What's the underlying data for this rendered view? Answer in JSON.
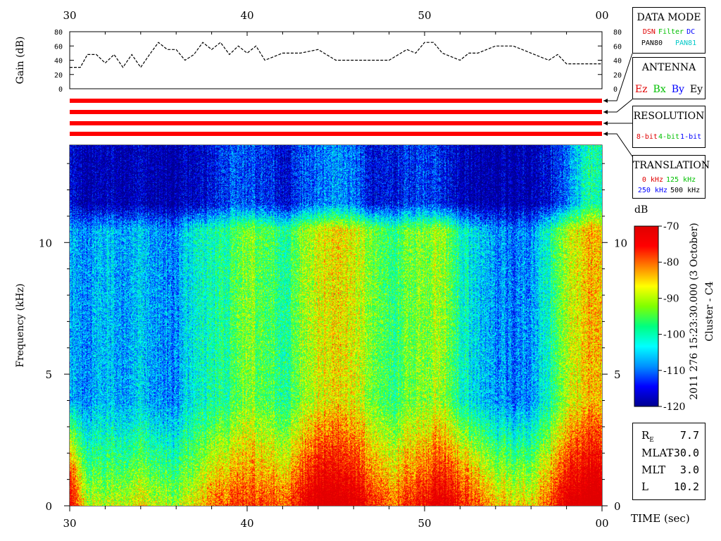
{
  "chart_data": {
    "type": "heatmap",
    "title": "2011 276 15:23:30.000 (3 October)",
    "subtitle": "Cluster - C4",
    "xlabel": "TIME (sec)",
    "x_tick_labels": [
      "30",
      "40",
      "50",
      "00"
    ],
    "xlim": [
      30,
      60
    ],
    "gain_panel": {
      "ylabel": "Gain (dB)",
      "ylim": [
        0,
        80
      ],
      "y_tick_labels": [
        "0",
        "20",
        "40",
        "60",
        "80"
      ],
      "series": {
        "x": [
          30,
          30.6,
          31,
          31.5,
          32,
          32.5,
          33,
          33.5,
          34,
          34.5,
          35,
          35.5,
          36,
          36.5,
          37,
          37.5,
          38,
          38.5,
          39,
          39.5,
          40,
          40.5,
          41,
          42,
          43,
          44,
          45,
          46,
          47,
          48,
          49,
          49.5,
          50,
          50.5,
          51,
          52,
          52.5,
          53,
          54,
          55,
          56,
          57,
          57.5,
          58,
          58.5,
          59,
          60
        ],
        "y": [
          30,
          30,
          48,
          48,
          36,
          48,
          30,
          48,
          30,
          48,
          65,
          55,
          55,
          40,
          48,
          65,
          55,
          65,
          48,
          60,
          50,
          60,
          40,
          50,
          50,
          55,
          40,
          40,
          40,
          40,
          55,
          50,
          65,
          65,
          50,
          40,
          50,
          50,
          60,
          60,
          50,
          40,
          48,
          35,
          35,
          35,
          35
        ]
      }
    },
    "indicator_bars": 4,
    "spectrogram": {
      "ylabel": "Frequency (kHz)",
      "ylim": [
        0,
        13.7
      ],
      "y_tick_labels": [
        "0",
        "5",
        "10"
      ],
      "colorbar": {
        "unit": "dB",
        "range": [
          -120,
          -70
        ],
        "tick_labels": [
          "-70",
          "-80",
          "-90",
          "-100",
          "-110",
          "-120"
        ],
        "colors": [
          "#000090",
          "#0000ff",
          "#0090ff",
          "#00ffff",
          "#00ff80",
          "#80ff00",
          "#ffff00",
          "#ff8000",
          "#ff0000",
          "#e00000"
        ]
      },
      "time_bins": [
        {
          "t": 30,
          "lowband": -78,
          "midband": -108,
          "upper": -118
        },
        {
          "t": 31,
          "lowband": -95,
          "midband": -108,
          "upper": -120
        },
        {
          "t": 32,
          "lowband": -96,
          "midband": -106,
          "upper": -119
        },
        {
          "t": 33,
          "lowband": -95,
          "midband": -108,
          "upper": -120
        },
        {
          "t": 34,
          "lowband": -92,
          "midband": -105,
          "upper": -118
        },
        {
          "t": 35,
          "lowband": -95,
          "midband": -108,
          "upper": -120
        },
        {
          "t": 36,
          "lowband": -97,
          "midband": -109,
          "upper": -120
        },
        {
          "t": 37,
          "lowband": -92,
          "midband": -102,
          "upper": -118
        },
        {
          "t": 38,
          "lowband": -86,
          "midband": -100,
          "upper": -116
        },
        {
          "t": 39,
          "lowband": -84,
          "midband": -98,
          "upper": -112
        },
        {
          "t": 40,
          "lowband": -82,
          "midband": -92,
          "upper": -112
        },
        {
          "t": 41,
          "lowband": -82,
          "midband": -94,
          "upper": -112
        },
        {
          "t": 42,
          "lowband": -86,
          "midband": -100,
          "upper": -118
        },
        {
          "t": 43,
          "lowband": -78,
          "midband": -92,
          "upper": -112
        },
        {
          "t": 44,
          "lowband": -72,
          "midband": -88,
          "upper": -110
        },
        {
          "t": 45,
          "lowband": -72,
          "midband": -86,
          "upper": -108
        },
        {
          "t": 46,
          "lowband": -74,
          "midband": -88,
          "upper": -110
        },
        {
          "t": 47,
          "lowband": -80,
          "midband": -92,
          "upper": -116
        },
        {
          "t": 48,
          "lowband": -86,
          "midband": -98,
          "upper": -116
        },
        {
          "t": 49,
          "lowband": -82,
          "midband": -94,
          "upper": -114
        },
        {
          "t": 50,
          "lowband": -78,
          "midband": -92,
          "upper": -112
        },
        {
          "t": 51,
          "lowband": -74,
          "midband": -90,
          "upper": -114
        },
        {
          "t": 52,
          "lowband": -80,
          "midband": -100,
          "upper": -118
        },
        {
          "t": 53,
          "lowband": -84,
          "midband": -104,
          "upper": -119
        },
        {
          "t": 54,
          "lowband": -90,
          "midband": -108,
          "upper": -120
        },
        {
          "t": 55,
          "lowband": -92,
          "midband": -110,
          "upper": -120
        },
        {
          "t": 56,
          "lowband": -92,
          "midband": -108,
          "upper": -119
        },
        {
          "t": 57,
          "lowband": -84,
          "midband": -100,
          "upper": -116
        },
        {
          "t": 58,
          "lowband": -74,
          "midband": -90,
          "upper": -110
        },
        {
          "t": 59,
          "lowband": -70,
          "midband": -84,
          "upper": -100
        }
      ]
    }
  },
  "legend_panels": {
    "data_mode": {
      "title": "DATA MODE",
      "row1": [
        {
          "text": "DSN",
          "color": "#e00000"
        },
        {
          "text": "Filter",
          "color": "#00c000"
        },
        {
          "text": "DC",
          "color": "#0000ff"
        }
      ],
      "row2": [
        {
          "text": "PAN80",
          "color": "#000000"
        },
        {
          "text": "PAN81",
          "color": "#00c8c8"
        }
      ]
    },
    "antenna": {
      "title": "ANTENNA",
      "items": [
        {
          "text": "Ez",
          "color": "#e00000"
        },
        {
          "text": "Bx",
          "color": "#00c000"
        },
        {
          "text": "By",
          "color": "#0000ff"
        },
        {
          "text": "Ey",
          "color": "#000000"
        }
      ]
    },
    "resolution": {
      "title": "RESOLUTION",
      "items": [
        {
          "text": "8-bit",
          "color": "#e00000"
        },
        {
          "text": "4-bit",
          "color": "#00c000"
        },
        {
          "text": "1-bit",
          "color": "#0000ff"
        }
      ]
    },
    "translation": {
      "title": "TRANSLATION",
      "row1": [
        {
          "text": "0 kHz",
          "color": "#e00000"
        },
        {
          "text": "125 kHz",
          "color": "#00c000"
        }
      ],
      "row2": [
        {
          "text": "250 kHz",
          "color": "#0000ff"
        },
        {
          "text": "500 kHz",
          "color": "#000000"
        }
      ]
    }
  },
  "orbit_info": {
    "re_label": "R",
    "re_sub": "E",
    "re_value": "7.7",
    "mlat_label": "MLAT",
    "mlat_value": "-30.0",
    "mlt_label": "MLT",
    "mlt_value": "3.0",
    "l_label": "L",
    "l_value": "10.2"
  },
  "indicator_color": "#ff0000"
}
